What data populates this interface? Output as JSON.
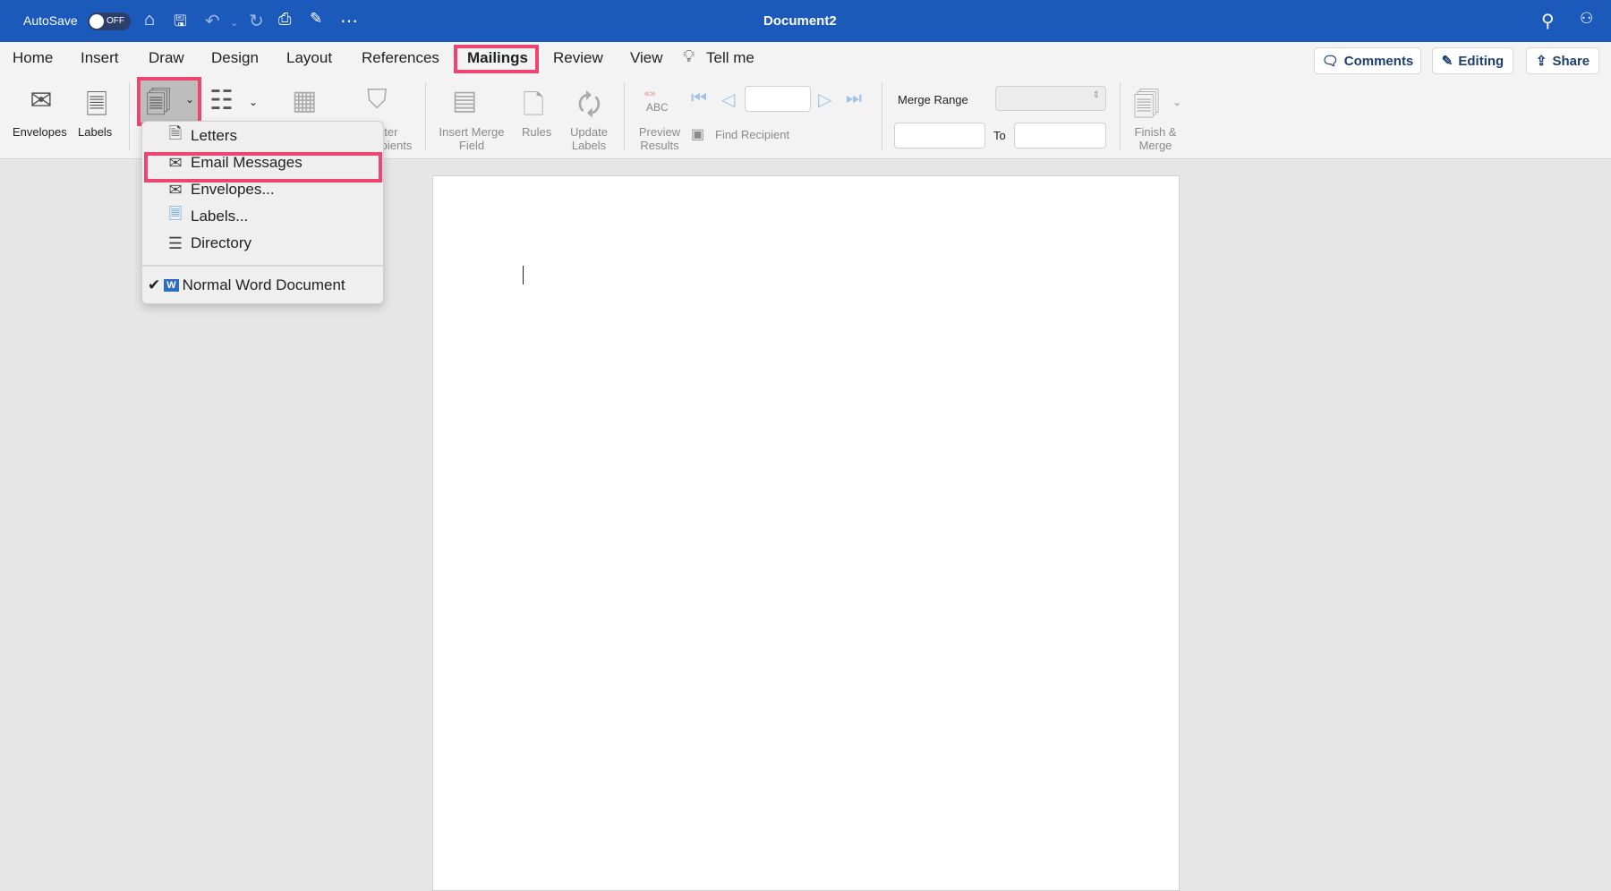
{
  "titlebar": {
    "autosave": "AutoSave",
    "toggle": "OFF",
    "title": "Document2"
  },
  "tabs": [
    "Home",
    "Insert",
    "Draw",
    "Design",
    "Layout",
    "References",
    "Mailings",
    "Review",
    "View"
  ],
  "tell_me": "Tell me",
  "right_buttons": {
    "comments": "Comments",
    "editing": "Editing",
    "share": "Share"
  },
  "ribbon": {
    "envelopes": "Envelopes",
    "labels": "Labels",
    "filter_recipients": "Filter Recipients",
    "insert_merge_field": "Insert Merge Field",
    "rules": "Rules",
    "update_labels": "Update Labels",
    "preview_results": "Preview Results",
    "abc": "ABC",
    "find_recipient": "Find Recipient",
    "merge_range": "Merge Range",
    "to": "To",
    "finish_merge": "Finish & Merge"
  },
  "menu": {
    "items": [
      "Letters",
      "Email Messages",
      "Envelopes...",
      "Labels...",
      "Directory"
    ],
    "normal": "Normal Word Document"
  },
  "colors": {
    "titlebar": "#1b59bb",
    "highlight": "#ee4570"
  }
}
